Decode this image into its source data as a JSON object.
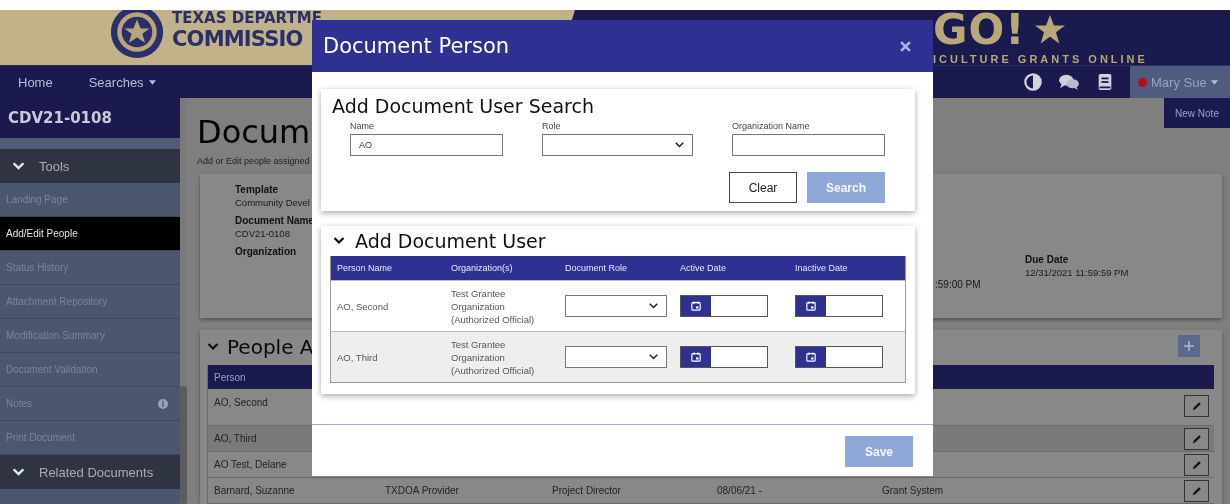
{
  "header": {
    "agency_lines": [
      "TEXAS DEPARTME",
      "COMMISSIO"
    ],
    "brand": "GO!",
    "tagline": "ICULTURE GRANTS ONLINE"
  },
  "nav": {
    "items": [
      {
        "label": "Home",
        "dropdown": false
      },
      {
        "label": "Searches",
        "dropdown": true
      }
    ],
    "user": {
      "name": "Mary Sue",
      "dropdown": true
    }
  },
  "sidebar": {
    "document_id": "CDV21-0108",
    "sections": [
      {
        "label": "Tools",
        "expanded": true,
        "items": [
          {
            "label": "Landing Page",
            "selected": false,
            "alert": false
          },
          {
            "label": "Add/Edit People",
            "selected": true,
            "alert": false
          },
          {
            "label": "Status History",
            "selected": false,
            "alert": false
          },
          {
            "label": "Attachment Repository",
            "selected": false,
            "alert": false
          },
          {
            "label": "Modification Summary",
            "selected": false,
            "alert": false
          },
          {
            "label": "Document Validation",
            "selected": false,
            "alert": false
          },
          {
            "label": "Notes",
            "selected": false,
            "alert": true
          },
          {
            "label": "Print Document",
            "selected": false,
            "alert": false
          }
        ]
      },
      {
        "label": "Related Documents",
        "expanded": true
      }
    ]
  },
  "main": {
    "title": "Docum",
    "subtitle": "Add or Edit people assigned",
    "new_note": "New Note",
    "details": [
      {
        "label": "Template",
        "value": "Community Devel"
      },
      {
        "label": "Document Name",
        "value": "CDV21-0108"
      },
      {
        "label": "Organization"
      }
    ],
    "partial_date": ":59:00 PM",
    "due_date": {
      "label": "Due Date",
      "value": "12/31/2021 11:59:59 PM"
    },
    "people": {
      "title": "People A",
      "expanded": true,
      "column": "Person",
      "rows": [
        {
          "cells": [
            "AO, Second"
          ],
          "tall": true
        },
        {
          "cells": [
            "AO, Third"
          ],
          "tall": false
        },
        {
          "cells": [
            "AO Test, Delane"
          ],
          "tall": false
        },
        {
          "cells": [
            "Barnard, Suzanne",
            "TXDOA Provider",
            "Project Director",
            "08/06/21 -",
            "Grant System"
          ],
          "tall": false
        }
      ]
    }
  },
  "modal": {
    "title": "Document Person",
    "search": {
      "title": "Add Document User Search",
      "fields": [
        {
          "label": "Name",
          "kind": "text",
          "value": "AO"
        },
        {
          "label": "Role",
          "kind": "select"
        },
        {
          "label": "Organization Name",
          "kind": "text"
        }
      ],
      "buttons": [
        {
          "label": "Clear",
          "kind": "secondary"
        },
        {
          "label": "Search",
          "kind": "primary"
        }
      ]
    },
    "results": {
      "title": "Add Document User",
      "expanded": true,
      "columns": [
        "Person Name",
        "Organization(s)",
        "Document Role",
        "Active Date",
        "Inactive Date"
      ],
      "rows": [
        {
          "name": "AO, Second",
          "organization": "Test Grantee Organization (Authorized Official)"
        },
        {
          "name": "AO, Third",
          "organization": "Test Grantee Organization (Authorized Official)"
        }
      ]
    },
    "save": "Save"
  }
}
